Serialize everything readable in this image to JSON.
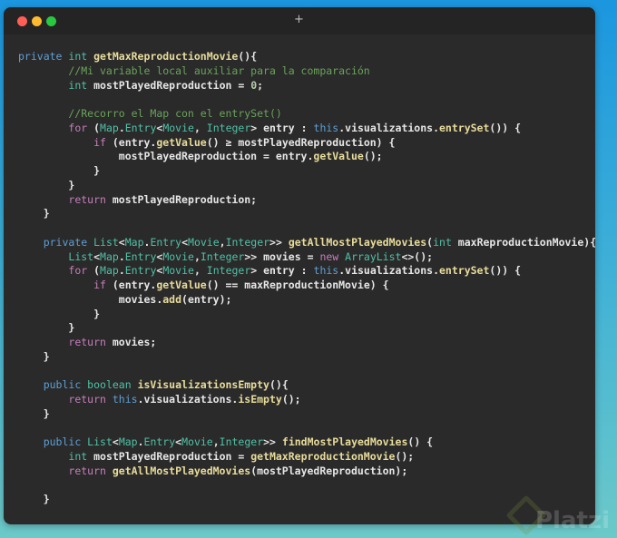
{
  "window": {
    "new_tab_label": "+"
  },
  "watermark": "Platzi",
  "code_lines": [
    [
      [
        "private ",
        "kw"
      ],
      [
        "int ",
        "ty"
      ],
      [
        "getMaxReproductionMovie",
        "fn"
      ],
      [
        "(){",
        "pl"
      ]
    ],
    [
      [
        "        //Mi variable local auxiliar para la comparación",
        "cm"
      ]
    ],
    [
      [
        "        ",
        "pl"
      ],
      [
        "int ",
        "ty"
      ],
      [
        "mostPlayedReproduction = ",
        "pl"
      ],
      [
        "0",
        "nu"
      ],
      [
        ";",
        "pl"
      ]
    ],
    [],
    [
      [
        "        //Recorro el Map con el entrySet()",
        "cm"
      ]
    ],
    [
      [
        "        ",
        "pl"
      ],
      [
        "for ",
        "ct"
      ],
      [
        "(",
        "pl"
      ],
      [
        "Map",
        "ty"
      ],
      [
        ".",
        "pl"
      ],
      [
        "Entry",
        "ty"
      ],
      [
        "<",
        "pl"
      ],
      [
        "Movie",
        "ty"
      ],
      [
        ", ",
        "pl"
      ],
      [
        "Integer",
        "ty"
      ],
      [
        "> entry : ",
        "pl"
      ],
      [
        "this",
        "kw"
      ],
      [
        ".visualizations.",
        "pl"
      ],
      [
        "entrySet",
        "fn"
      ],
      [
        "()) {",
        "pl"
      ]
    ],
    [
      [
        "            ",
        "pl"
      ],
      [
        "if ",
        "ct"
      ],
      [
        "(entry.",
        "pl"
      ],
      [
        "getValue",
        "fn"
      ],
      [
        "() ≥ mostPlayedReproduction) {",
        "pl"
      ]
    ],
    [
      [
        "                mostPlayedReproduction = entry.",
        "pl"
      ],
      [
        "getValue",
        "fn"
      ],
      [
        "();",
        "pl"
      ]
    ],
    [
      [
        "            }",
        "pl"
      ]
    ],
    [
      [
        "        }",
        "pl"
      ]
    ],
    [
      [
        "        ",
        "pl"
      ],
      [
        "return ",
        "ct"
      ],
      [
        "mostPlayedReproduction;",
        "pl"
      ]
    ],
    [
      [
        "    }",
        "pl"
      ]
    ],
    [],
    [
      [
        "    ",
        "pl"
      ],
      [
        "private ",
        "kw"
      ],
      [
        "List",
        "ty"
      ],
      [
        "<",
        "pl"
      ],
      [
        "Map",
        "ty"
      ],
      [
        ".",
        "pl"
      ],
      [
        "Entry",
        "ty"
      ],
      [
        "<",
        "pl"
      ],
      [
        "Movie",
        "ty"
      ],
      [
        ",",
        "pl"
      ],
      [
        "Integer",
        "ty"
      ],
      [
        ">> ",
        "pl"
      ],
      [
        "getAllMostPlayedMovies",
        "fn"
      ],
      [
        "(",
        "pl"
      ],
      [
        "int ",
        "ty"
      ],
      [
        "maxReproductionMovie){",
        "pl"
      ]
    ],
    [
      [
        "        ",
        "pl"
      ],
      [
        "List",
        "ty"
      ],
      [
        "<",
        "pl"
      ],
      [
        "Map",
        "ty"
      ],
      [
        ".",
        "pl"
      ],
      [
        "Entry",
        "ty"
      ],
      [
        "<",
        "pl"
      ],
      [
        "Movie",
        "ty"
      ],
      [
        ",",
        "pl"
      ],
      [
        "Integer",
        "ty"
      ],
      [
        ">> movies = ",
        "pl"
      ],
      [
        "new ",
        "ct"
      ],
      [
        "ArrayList",
        "ty"
      ],
      [
        "<>();",
        "pl"
      ]
    ],
    [
      [
        "        ",
        "pl"
      ],
      [
        "for ",
        "ct"
      ],
      [
        "(",
        "pl"
      ],
      [
        "Map",
        "ty"
      ],
      [
        ".",
        "pl"
      ],
      [
        "Entry",
        "ty"
      ],
      [
        "<",
        "pl"
      ],
      [
        "Movie",
        "ty"
      ],
      [
        ", ",
        "pl"
      ],
      [
        "Integer",
        "ty"
      ],
      [
        "> entry : ",
        "pl"
      ],
      [
        "this",
        "kw"
      ],
      [
        ".visualizations.",
        "pl"
      ],
      [
        "entrySet",
        "fn"
      ],
      [
        "()) {",
        "pl"
      ]
    ],
    [
      [
        "            ",
        "pl"
      ],
      [
        "if ",
        "ct"
      ],
      [
        "(entry.",
        "pl"
      ],
      [
        "getValue",
        "fn"
      ],
      [
        "() == maxReproductionMovie) {",
        "pl"
      ]
    ],
    [
      [
        "                movies.",
        "pl"
      ],
      [
        "add",
        "fn"
      ],
      [
        "(entry);",
        "pl"
      ]
    ],
    [
      [
        "            }",
        "pl"
      ]
    ],
    [
      [
        "        }",
        "pl"
      ]
    ],
    [
      [
        "        ",
        "pl"
      ],
      [
        "return ",
        "ct"
      ],
      [
        "movies;",
        "pl"
      ]
    ],
    [
      [
        "    }",
        "pl"
      ]
    ],
    [],
    [
      [
        "    ",
        "pl"
      ],
      [
        "public ",
        "kw"
      ],
      [
        "boolean ",
        "ty"
      ],
      [
        "isVisualizationsEmpty",
        "fn"
      ],
      [
        "(){",
        "pl"
      ]
    ],
    [
      [
        "        ",
        "pl"
      ],
      [
        "return ",
        "ct"
      ],
      [
        "this",
        "kw"
      ],
      [
        ".visualizations.",
        "pl"
      ],
      [
        "isEmpty",
        "fn"
      ],
      [
        "();",
        "pl"
      ]
    ],
    [
      [
        "    }",
        "pl"
      ]
    ],
    [],
    [
      [
        "    ",
        "pl"
      ],
      [
        "public ",
        "kw"
      ],
      [
        "List",
        "ty"
      ],
      [
        "<",
        "pl"
      ],
      [
        "Map",
        "ty"
      ],
      [
        ".",
        "pl"
      ],
      [
        "Entry",
        "ty"
      ],
      [
        "<",
        "pl"
      ],
      [
        "Movie",
        "ty"
      ],
      [
        ",",
        "pl"
      ],
      [
        "Integer",
        "ty"
      ],
      [
        ">> ",
        "pl"
      ],
      [
        "findMostPlayedMovies",
        "fn"
      ],
      [
        "() {",
        "pl"
      ]
    ],
    [
      [
        "        ",
        "pl"
      ],
      [
        "int ",
        "ty"
      ],
      [
        "mostPlayedReproduction = ",
        "pl"
      ],
      [
        "getMaxReproductionMovie",
        "fn"
      ],
      [
        "();",
        "pl"
      ]
    ],
    [
      [
        "        ",
        "pl"
      ],
      [
        "return ",
        "ct"
      ],
      [
        "getAllMostPlayedMovies",
        "fn"
      ],
      [
        "(mostPlayedReproduction);",
        "pl"
      ]
    ],
    [],
    [
      [
        "    }",
        "pl"
      ]
    ]
  ]
}
